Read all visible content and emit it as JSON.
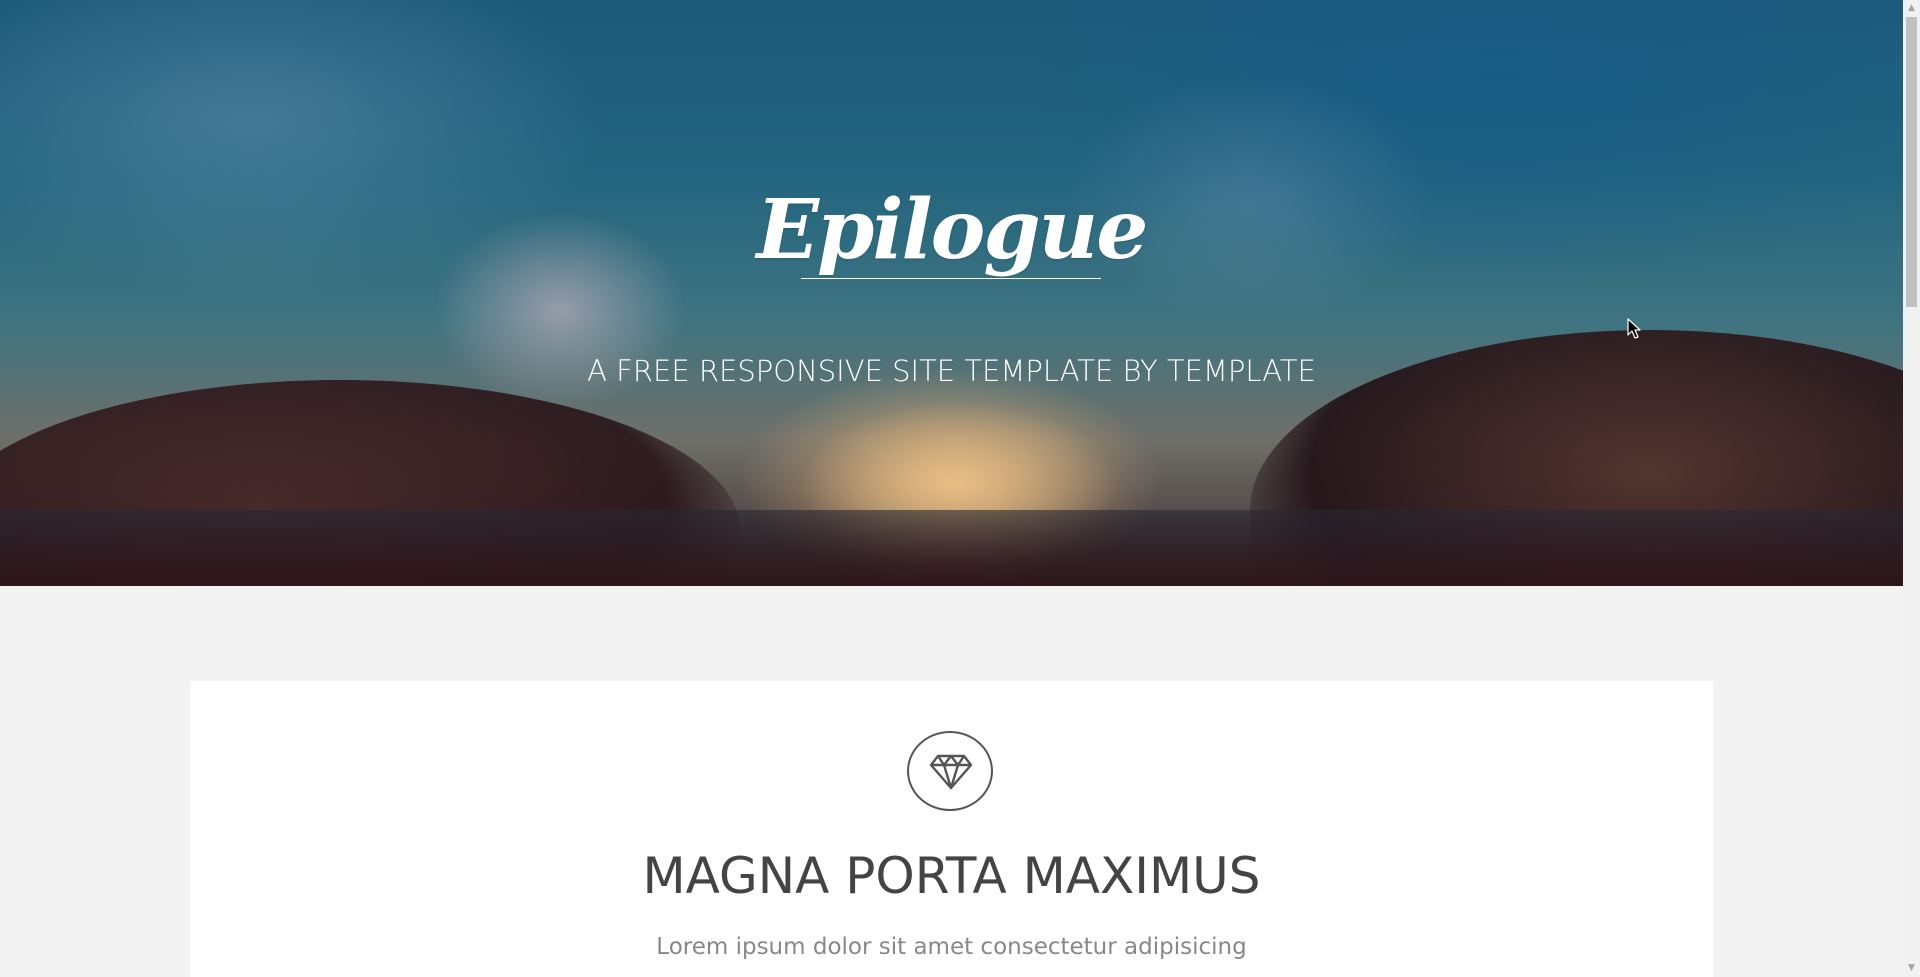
{
  "hero": {
    "logo": "Epilogue",
    "tagline": "A FREE RESPONSIVE SITE TEMPLATE BY TEMPLATE"
  },
  "feature": {
    "icon": "diamond-icon",
    "title": "MAGNA PORTA MAXIMUS",
    "text": "Lorem ipsum dolor sit amet consectetur adipisicing"
  },
  "colors": {
    "page_background": "#f3f3f3",
    "card_background": "#ffffff",
    "title_color": "#444444",
    "text_color": "#888888",
    "hero_text": "#ffffff"
  }
}
